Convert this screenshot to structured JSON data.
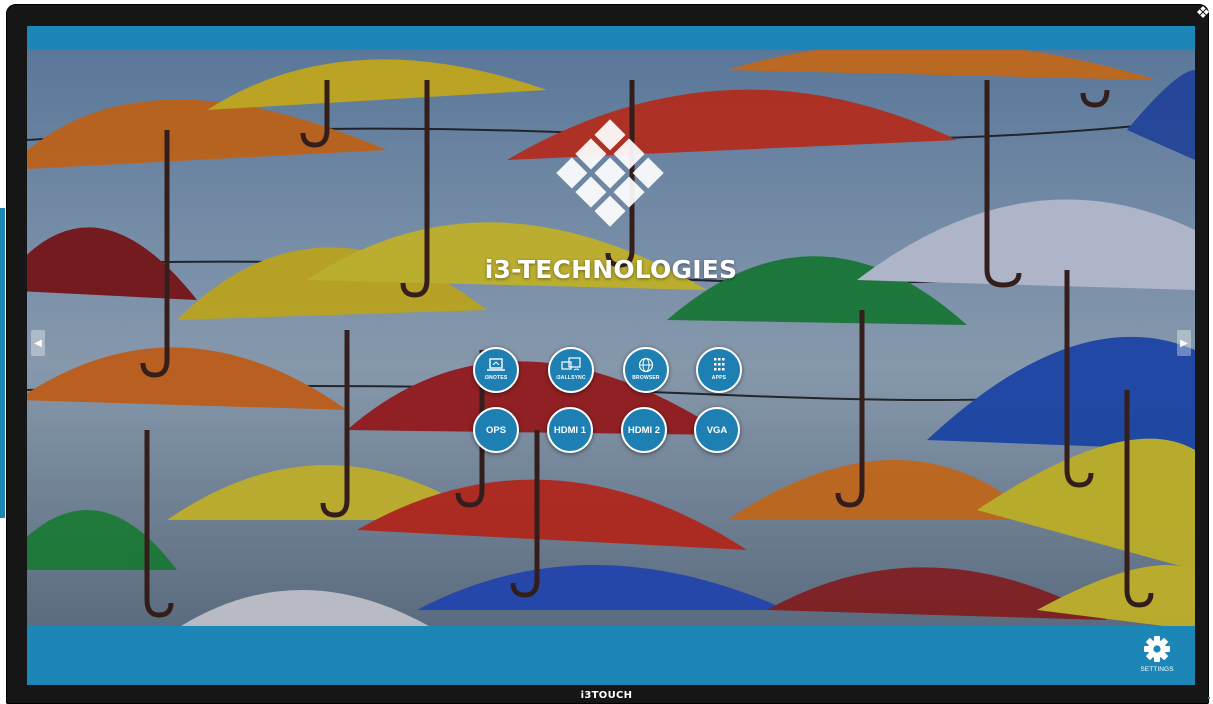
{
  "brand": {
    "name": "i3-TECHNOLOGIES",
    "device_label": "i3TOUCH"
  },
  "launcher": {
    "tiles": [
      {
        "id": "i3notes",
        "label": "i3NOTES",
        "icon": "laptop-icon"
      },
      {
        "id": "i3allsync",
        "label": "i3ALLSYNC",
        "icon": "screen-share-icon"
      },
      {
        "id": "browser",
        "label": "BROWSER",
        "icon": "globe-icon"
      },
      {
        "id": "apps",
        "label": "APPS",
        "icon": "grid-icon"
      }
    ],
    "sources": [
      {
        "id": "ops",
        "label": "OPS"
      },
      {
        "id": "hdmi1",
        "label": "HDMI 1"
      },
      {
        "id": "hdmi2",
        "label": "HDMI 2"
      },
      {
        "id": "vga",
        "label": "VGA"
      }
    ]
  },
  "settings": {
    "label": "SETTINGS",
    "icon": "gear-icon"
  },
  "colors": {
    "bar": "#1c86b6",
    "tile": "#1d7fb2",
    "bezel": "#161616"
  }
}
